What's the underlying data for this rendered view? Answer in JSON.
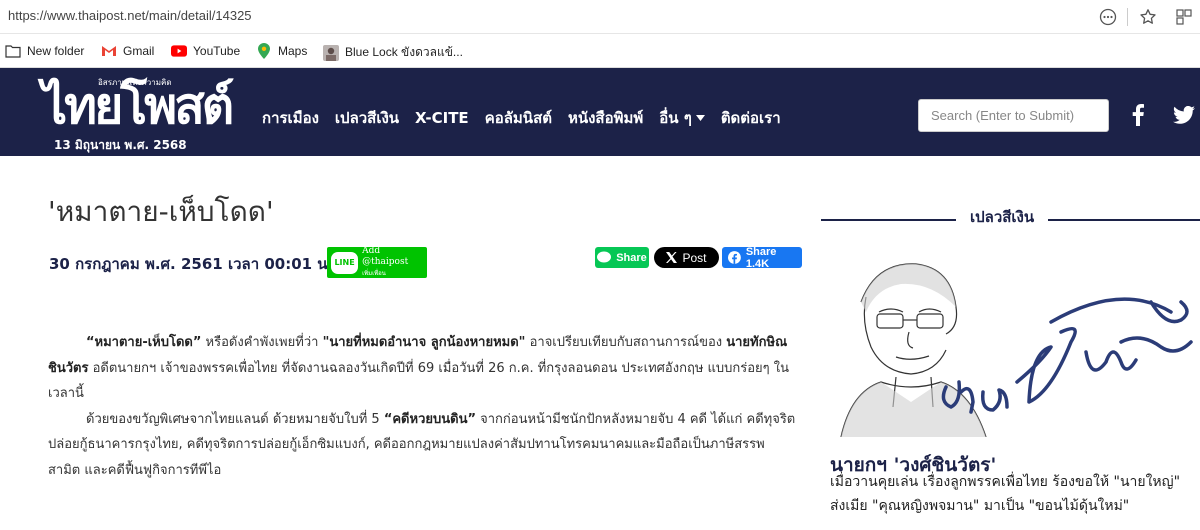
{
  "browser": {
    "url": "https://www.thaipost.net/main/detail/14325",
    "bookmarks": [
      {
        "label": "New folder",
        "icon": "folder-icon"
      },
      {
        "label": "Gmail",
        "icon": "gmail-icon"
      },
      {
        "label": "YouTube",
        "icon": "youtube-icon"
      },
      {
        "label": "Maps",
        "icon": "maps-icon"
      },
      {
        "label": "Blue Lock ขังดวลแข้...",
        "icon": "bluelock-icon"
      }
    ]
  },
  "header": {
    "logo_text": "ไทยโพสต์",
    "logo_tagline": "อิสรภาพแห่งความคิด",
    "date": "13 มิถุนายน พ.ศ. 2568",
    "nav": [
      "การเมือง",
      "เปลวสีเงิน",
      "X-CITE",
      "คอลัมนิสต์",
      "หนังสือพิมพ์",
      "อื่น ๆ",
      "ติดต่อเรา"
    ],
    "search_placeholder": "Search (Enter to Submit)",
    "colors": {
      "navy": "#1c2248",
      "line_green": "#00c300",
      "facebook_blue": "#1877f2"
    }
  },
  "article": {
    "title": "'หมาตาย-เห็บโดด'",
    "date": "30 กรกฎาคม พ.ศ. 2561 เวลา 00:01 น.",
    "line_add": "Add @thaipost",
    "line_add_sub": "เพิ่มเพื่อน",
    "line_badge": "LINE",
    "share_line": "Share",
    "share_x": "Post",
    "share_fb": "Share 1.4K",
    "p1": {
      "q1": "“หมาตาย-เห็บโดด”",
      "t1": " หรือดังคำพังเพยที่ว่า ",
      "q2": "\"นายที่หมดอำนาจ ลูกน้องหายหมด\"",
      "t2": " อาจเปรียบเทียบกับสถานการณ์ของ ",
      "name": "นายทักษิณ ชินวัตร",
      "t3": " อดีตนายกฯ เจ้าของพรรคเพื่อไทย ที่จัดงานฉลองวันเกิดปีที่ 69 เมื่อวันที่ 26 ก.ค. ที่กรุงลอนดอน ประเทศอังกฤษ แบบกร่อยๆ ในเวลานี้"
    },
    "p2": {
      "t1": "ด้วยของขวัญพิเศษจากไทยแลนด์ ด้วยหมายจับใบที่ 5 ",
      "q1": "“คดีหวยบนดิน”",
      "t2": " จากก่อนหน้ามีชนักปักหลังหมายจับ 4 คดี ได้แก่ คดีทุจริตปล่อยกู้ธนาคารกรุงไทย, คดีทุจริตการปล่อยกู้เอ็กซิมแบงก์, คดีออกกฎหมายแปลงค่าสัมปทานโทรคมนาคมและมือถือเป็นภาษีสรรพสามิต และคดีฟื้นฟูกิจการทีพีไอ"
    }
  },
  "sidebar": {
    "heading": "เปลวสีเงิน",
    "image_signature": "เปลว สีเงิน",
    "headline": "นายกฯ 'วงศ์ชินวัตร'",
    "summary": "เมื่อวานคุยเล่น เรื่องลูกพรรคเพื่อไทย ร้องขอให้ \"นายใหญ่\" ส่งเมีย \"คุณหญิงพจมาน\" มาเป็น \"ขอนไม้ดุ้นใหม่\""
  }
}
